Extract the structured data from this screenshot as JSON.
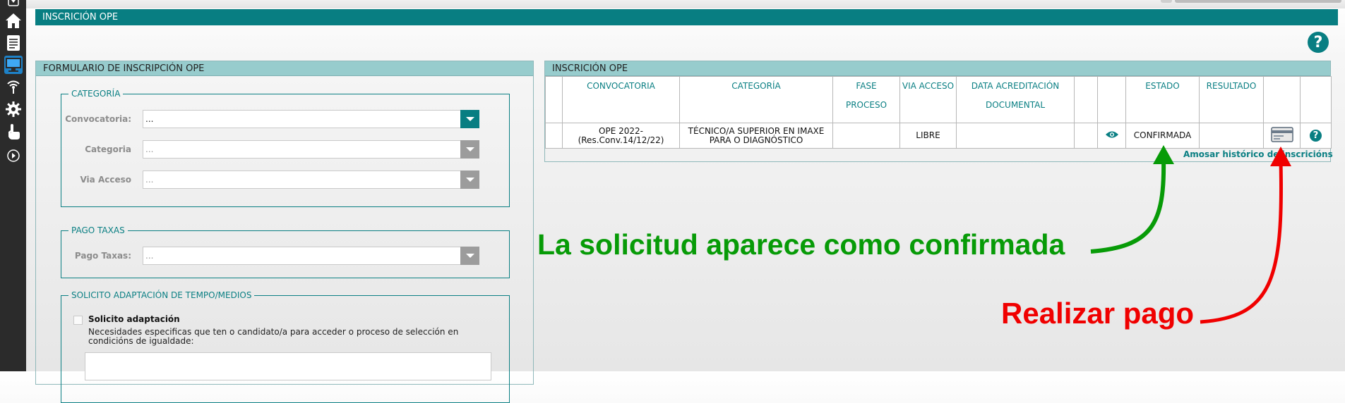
{
  "header": {
    "title": "INSCRICIÓN OPE"
  },
  "sidebar": {
    "items": [
      {
        "icon": "home-icon"
      },
      {
        "icon": "document-icon"
      },
      {
        "icon": "monitor-icon",
        "active": true
      },
      {
        "icon": "wireless-icon"
      },
      {
        "icon": "gear-icon"
      },
      {
        "icon": "hand-pointer-icon"
      },
      {
        "icon": "play-circle-icon"
      }
    ]
  },
  "form_panel": {
    "title": "FORMULARIO DE INSCRIPCIÓN OPE",
    "categoria_group": {
      "legend": "CATEGORÍA",
      "fields": [
        {
          "label": "Convocatoria:",
          "value": "..."
        },
        {
          "label": "Categoria",
          "value": "..."
        },
        {
          "label": "Via Acceso",
          "value": "..."
        }
      ]
    },
    "pago_group": {
      "legend": "PAGO TAXAS",
      "fields": [
        {
          "label": "Pago Taxas:",
          "value": "..."
        }
      ]
    },
    "adaptacion_group": {
      "legend": "SOLICITO ADAPTACIÓN DE TEMPO/MEDIOS",
      "checkbox_label": "Solicito adaptación",
      "checked": false,
      "description": "Necesidades especificas que ten o candidato/a para acceder o proceso de selección en condicións de igualdade:"
    }
  },
  "inscription_panel": {
    "title": "INSCRICIÓN OPE",
    "columns": [
      "",
      "CONVOCATORIA",
      "CATEGORÍA",
      "FASE PROCESO",
      "VIA ACCESO",
      "DATA ACREDITACIÓN DOCUMENTAL",
      "",
      "",
      "ESTADO",
      "RESULTADO",
      "",
      ""
    ],
    "rows": [
      {
        "convocatoria": "OPE 2022- (Res.Conv.14/12/22)",
        "categoria": "TÉCNICO/A SUPERIOR EN IMAXE PARA O DIAGNÓSTICO",
        "fase_proceso": "",
        "via_acceso": "LIBRE",
        "data_acreditacion": "",
        "estado": "CONFIRMADA",
        "resultado": ""
      }
    ],
    "history_link": "Amosar histórico de inscricións"
  },
  "annotations": {
    "green_text": "La solicitud aparece como confirmada",
    "red_text": "Realizar pago",
    "green_color": "#079b07",
    "red_color": "#f00000"
  },
  "colors": {
    "accent": "#087e82",
    "panel_header": "#97cccd"
  }
}
